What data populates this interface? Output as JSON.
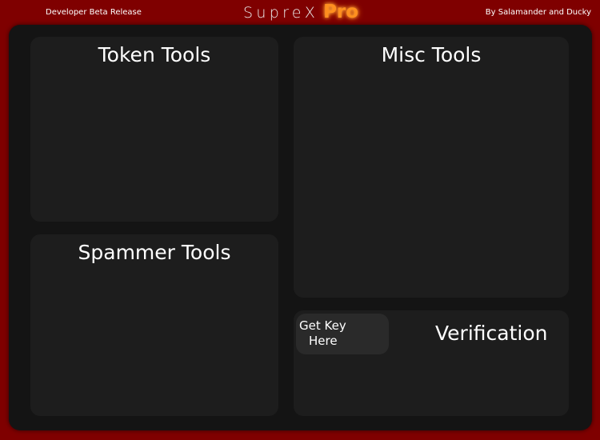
{
  "header": {
    "release_label": "Developer Beta Release",
    "brand_name": "SupreX",
    "brand_suffix": "Pro",
    "credits": "By Salamander and Ducky"
  },
  "panels": {
    "token_tools": {
      "title": "Token Tools"
    },
    "spammer_tools": {
      "title": "Spammer Tools"
    },
    "misc_tools": {
      "title": "Misc Tools"
    },
    "verification": {
      "title": "Verification",
      "get_key_line1": "Get Key",
      "get_key_line2": "Here"
    }
  },
  "colors": {
    "frame_background": "#7f0000",
    "main_background": "#141414",
    "panel_background": "#1d1d1d",
    "button_background": "#2a2a2a",
    "brand_accent": "#ff8f1f",
    "text": "#ffffff"
  }
}
